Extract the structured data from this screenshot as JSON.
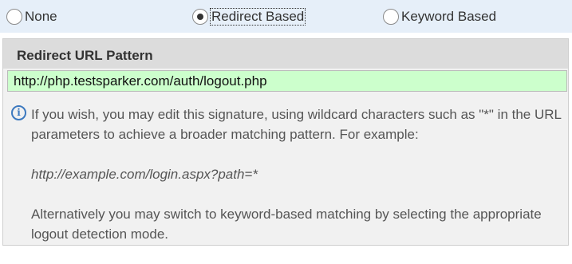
{
  "detection_mode": {
    "options": [
      {
        "label": "None",
        "checked": false
      },
      {
        "label": "Redirect Based",
        "checked": true
      },
      {
        "label": "Keyword Based",
        "checked": false
      }
    ]
  },
  "panel": {
    "title": "Redirect URL Pattern",
    "url_value": "http://php.testsparker.com/auth/logout.php",
    "url_field_color": "#ccffcc",
    "info_icon": "info-icon",
    "info": {
      "line1": "If you wish, you may edit this signature, using wildcard characters such as \"*\" in the URL parameters to achieve a broader matching pattern. For example:",
      "example": "http://example.com/login.aspx?path=*",
      "line2": "Alternatively you may switch to keyword-based matching by selecting the appropriate logout detection mode."
    }
  },
  "colors": {
    "radio_bar_bg": "#e6eff9",
    "panel_header_bg": "#dcdcdc",
    "info_icon": "#3c79bf"
  }
}
